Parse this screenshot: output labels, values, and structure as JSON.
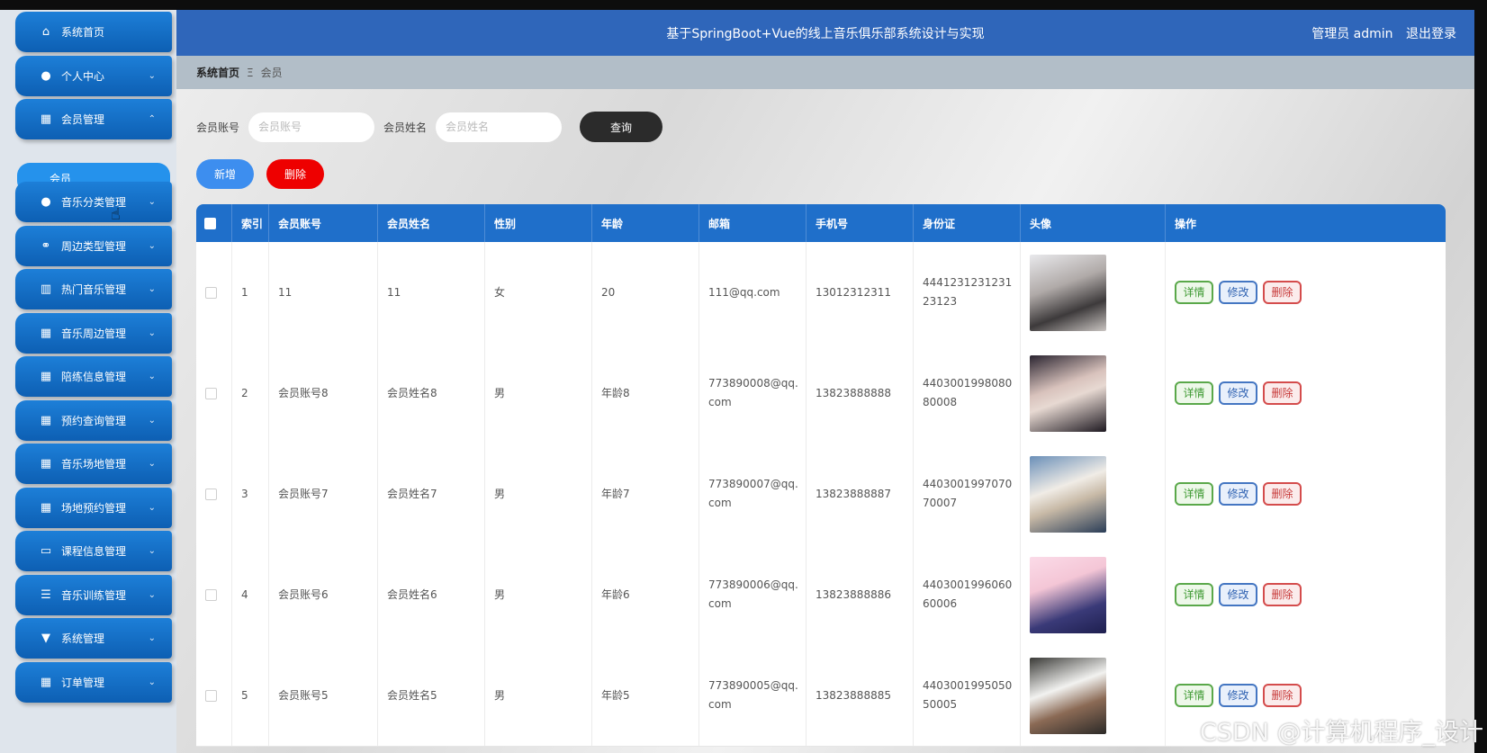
{
  "header": {
    "title": "基于SpringBoot+Vue的线上音乐俱乐部系统设计与实现",
    "user": "管理员 admin",
    "logout": "退出登录"
  },
  "breadcrumb": {
    "home": "系统首页",
    "separator": "Ξ",
    "current": "会员"
  },
  "sidebar": {
    "items": [
      {
        "label": "系统首页",
        "icon": "home-icon",
        "caret": ""
      },
      {
        "label": "个人中心",
        "icon": "user-icon",
        "caret": "⌄"
      },
      {
        "label": "会员管理",
        "icon": "grid-icon",
        "caret": "⌃"
      },
      {
        "label": "音乐分类管理",
        "icon": "user-icon",
        "caret": "⌄"
      },
      {
        "label": "周边类型管理",
        "icon": "link-icon",
        "caret": "⌄"
      },
      {
        "label": "热门音乐管理",
        "icon": "bar-chart-icon",
        "caret": "⌄"
      },
      {
        "label": "音乐周边管理",
        "icon": "grid-icon",
        "caret": "⌄"
      },
      {
        "label": "陪练信息管理",
        "icon": "grid-icon",
        "caret": "⌄"
      },
      {
        "label": "预约查询管理",
        "icon": "grid-icon",
        "caret": "⌄"
      },
      {
        "label": "音乐场地管理",
        "icon": "grid-icon",
        "caret": "⌄"
      },
      {
        "label": "场地预约管理",
        "icon": "grid-icon",
        "caret": "⌄"
      },
      {
        "label": "课程信息管理",
        "icon": "monitor-icon",
        "caret": "⌄"
      },
      {
        "label": "音乐训练管理",
        "icon": "sliders-icon",
        "caret": "⌄"
      },
      {
        "label": "系统管理",
        "icon": "pin-icon",
        "caret": "⌄"
      },
      {
        "label": "订单管理",
        "icon": "grid-icon",
        "caret": "⌄"
      }
    ],
    "submenu": {
      "label": "会员"
    }
  },
  "search": {
    "account_label": "会员账号",
    "account_placeholder": "会员账号",
    "account_value": "",
    "name_label": "会员姓名",
    "name_placeholder": "会员姓名",
    "name_value": "",
    "query_label": "查询"
  },
  "actions": {
    "add_label": "新增",
    "delete_label": "删除"
  },
  "table": {
    "columns": [
      "索引",
      "会员账号",
      "会员姓名",
      "性别",
      "年龄",
      "邮箱",
      "手机号",
      "身份证",
      "头像",
      "操作"
    ],
    "rows": [
      {
        "index": "1",
        "account": "11",
        "name": "11",
        "gender": "女",
        "age": "20",
        "email": "111@qq.com",
        "phone": "13012312311",
        "id_card": "444123123123123123"
      },
      {
        "index": "2",
        "account": "会员账号8",
        "name": "会员姓名8",
        "gender": "男",
        "age": "年龄8",
        "email": "773890008@qq.com",
        "phone": "13823888888",
        "id_card": "440300199808080008"
      },
      {
        "index": "3",
        "account": "会员账号7",
        "name": "会员姓名7",
        "gender": "男",
        "age": "年龄7",
        "email": "773890007@qq.com",
        "phone": "13823888887",
        "id_card": "440300199707070007"
      },
      {
        "index": "4",
        "account": "会员账号6",
        "name": "会员姓名6",
        "gender": "男",
        "age": "年龄6",
        "email": "773890006@qq.com",
        "phone": "13823888886",
        "id_card": "440300199606060006"
      },
      {
        "index": "5",
        "account": "会员账号5",
        "name": "会员姓名5",
        "gender": "男",
        "age": "年龄5",
        "email": "773890005@qq.com",
        "phone": "13823888885",
        "id_card": "440300199505050005"
      }
    ],
    "row_actions": {
      "detail": "详情",
      "edit": "修改",
      "delete": "删除"
    }
  },
  "watermark": "CSDN @计算机程序_设计",
  "colors": {
    "header": "#2f66ba",
    "sidebar_item": "#1d7fd8",
    "table_header": "#1f6fca",
    "delete": "#ee0000",
    "add": "#3d8eef"
  }
}
